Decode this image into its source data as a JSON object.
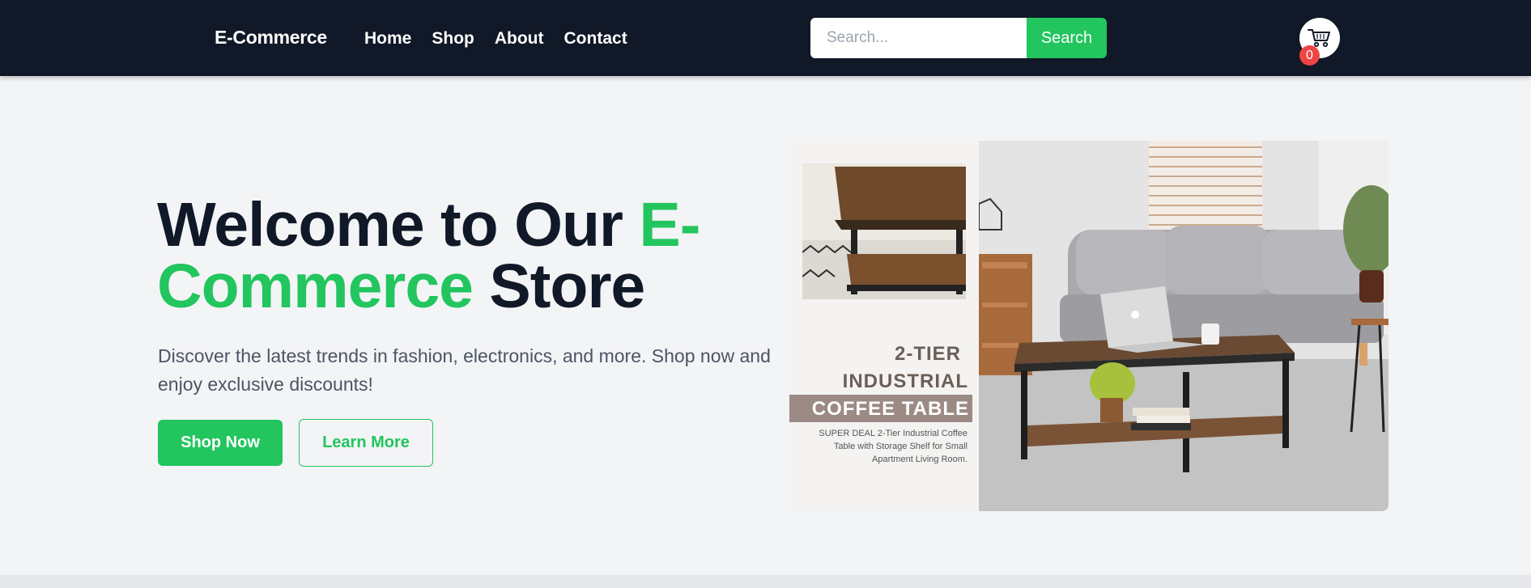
{
  "header": {
    "brand": "E-Commerce",
    "nav": [
      "Home",
      "Shop",
      "About",
      "Contact"
    ],
    "search_placeholder": "Search...",
    "search_button": "Search",
    "cart_count": "0"
  },
  "hero": {
    "title_part1": "Welcome to Our ",
    "title_accent": "E-Commerce",
    "title_part2": " Store",
    "subtitle": "Discover the latest trends in fashion, electronics, and more. Shop now and enjoy exclusive discounts!",
    "primary_button": "Shop Now",
    "secondary_button": "Learn More"
  },
  "product_image": {
    "line1": "2-TIER",
    "line2": "INDUSTRIAL",
    "line3": "COFFEE TABLE",
    "description": "SUPER DEAL 2-Tier Industrial Coffee Table with Storage Shelf for Small Apartment Living Room."
  },
  "colors": {
    "header_bg": "#111827",
    "accent": "#22c55e",
    "badge": "#ef4444",
    "page_bg": "#f3f4f6"
  }
}
